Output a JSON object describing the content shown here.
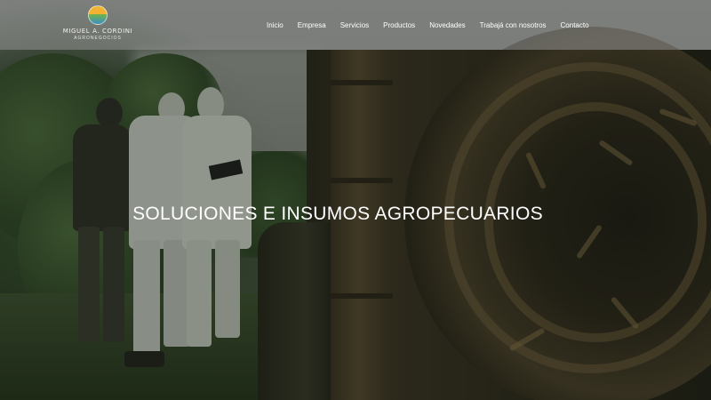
{
  "logo": {
    "name": "MIGUEL A. CORDINI",
    "subtitle": "AGRONEGOCIOS",
    "colors": {
      "sun": "#f2b233",
      "field": "#6fb24a",
      "water": "#3b8fc6"
    }
  },
  "nav": {
    "items": [
      {
        "label": "Inicio"
      },
      {
        "label": "Empresa"
      },
      {
        "label": "Servicios"
      },
      {
        "label": "Productos"
      },
      {
        "label": "Novedades"
      },
      {
        "label": "Trabajá con nosotros"
      },
      {
        "label": "Contacto"
      }
    ]
  },
  "hero": {
    "title": "SOLUCIONES E INSUMOS AGROPECUARIOS",
    "image": "agricultural workers in protective suits beside sprayer machine"
  }
}
